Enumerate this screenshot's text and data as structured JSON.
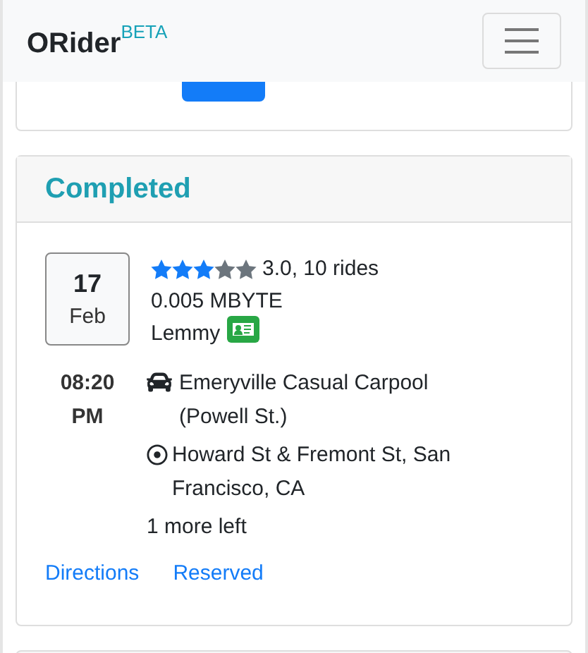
{
  "navbar": {
    "brand": "ORider",
    "badge": "BETA"
  },
  "completed": {
    "title": "Completed",
    "ride": {
      "day": "17",
      "month": "Feb",
      "stars": 3,
      "rating": "3.0, 10 rides",
      "price": "0.005 MBYTE",
      "driver": "Lemmy",
      "verified": true,
      "time": "08:20",
      "period": "PM",
      "pickup": "Emeryville Casual Carpool (Powell St.)",
      "dropoff": "Howard St & Fremont St, San Francisco, CA",
      "seats": "1 more left",
      "links": [
        "Directions",
        "Reserved"
      ]
    }
  }
}
